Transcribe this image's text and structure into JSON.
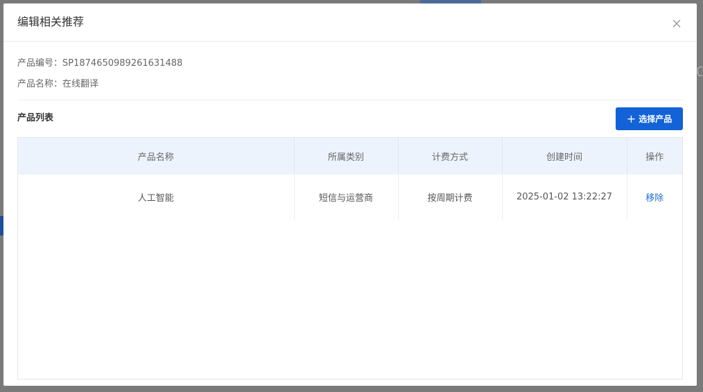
{
  "modal": {
    "title": "编辑相关推荐",
    "close_icon": "close-icon"
  },
  "product_info": {
    "id_label": "产品编号：",
    "id_value": "SP1874650989261631488",
    "name_label": "产品名称：",
    "name_value": "在线翻译"
  },
  "product_list": {
    "section_title": "产品列表",
    "select_button_label": "选择产品",
    "select_button_icon": "plus-icon",
    "columns": [
      "产品名称",
      "所属类别",
      "计费方式",
      "创建时间",
      "操作"
    ],
    "rows": [
      {
        "name": "人工智能",
        "category": "短信与运营商",
        "billing": "按周期计费",
        "created": "2025-01-02 13:22:27",
        "action": "移除"
      }
    ]
  },
  "colors": {
    "primary": "#1362d8",
    "link": "#1f6fd0",
    "header_bg": "#edf3fd"
  }
}
